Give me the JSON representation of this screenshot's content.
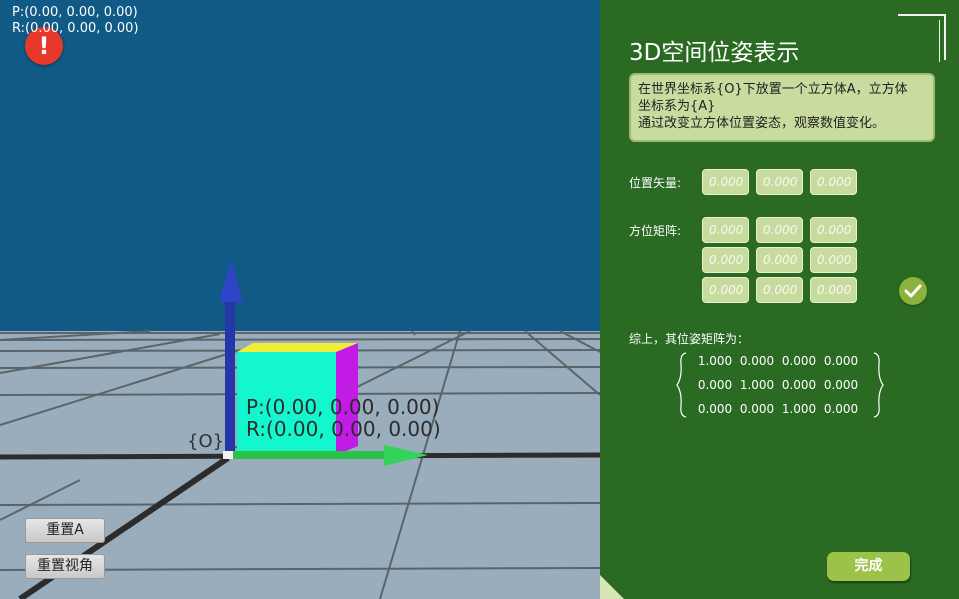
{
  "viewport": {
    "hud_position": "P:(0.00, 0.00, 0.00)",
    "hud_rotation": "R:(0.00, 0.00, 0.00)",
    "warning_symbol": "!",
    "cube_position_label": "P:(0.00, 0.00, 0.00)",
    "cube_rotation_label": "R:(0.00, 0.00, 0.00)",
    "world_frame_label": "{O}",
    "reset_a_label": "重置A",
    "reset_view_label": "重置视角",
    "colors": {
      "sky": "#115a85",
      "floor": "#9aadbc",
      "grid": "#555f66",
      "cube_front": "#13f7cf",
      "cube_side": "#c21be6",
      "cube_top": "#efef3a",
      "z_axis": "#2536a8",
      "x_axis": "#2bc24b"
    }
  },
  "panel": {
    "title": "3D空间位姿表示",
    "description_lines": [
      "在世界坐标系{O}下放置一个立方体A，立方体",
      "坐标系为{A}",
      "通过改变立方体位置姿态，观察数值变化。"
    ],
    "position_label": "位置矢量:",
    "position_placeholders": [
      "0.000",
      "0.000",
      "0.000"
    ],
    "rotation_label": "方位矩阵:",
    "rotation_placeholders": [
      [
        "0.000",
        "0.000",
        "0.000"
      ],
      [
        "0.000",
        "0.000",
        "0.000"
      ],
      [
        "0.000",
        "0.000",
        "0.000"
      ]
    ],
    "confirm_icon": "check-circle-icon",
    "summary_label": "综上，其位姿矩阵为：",
    "pose_matrix": [
      [
        "1.000",
        "0.000",
        "0.000",
        "0.000"
      ],
      [
        "0.000",
        "1.000",
        "0.000",
        "0.000"
      ],
      [
        "0.000",
        "0.000",
        "1.000",
        "0.000"
      ]
    ],
    "done_label": "完成",
    "colors": {
      "background": "#2a6a23",
      "input_fill": "#c8db9e",
      "accent_button": "#9dc24a"
    }
  }
}
